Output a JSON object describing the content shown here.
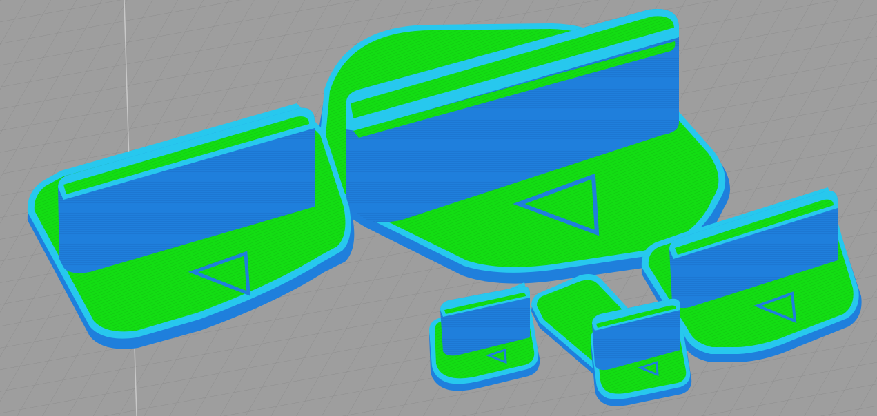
{
  "viewport": {
    "view": "3d-gcode-preview",
    "colors": {
      "bed": "#9e9e9e",
      "grid_line": "#8a8a8a",
      "grid_line_major": "#b0b0b0",
      "perimeter": "#1f7fdc",
      "perimeter_dark": "#1a6bc2",
      "outer_wall": "#27c8ee",
      "top_infill": "#13dd13",
      "top_infill_dark": "#0fbf0f"
    }
  },
  "parts": [
    {
      "name": "stand-large",
      "icon": "triangle-marker-icon"
    },
    {
      "name": "stand-medium-left",
      "icon": "triangle-marker-icon"
    },
    {
      "name": "stand-medium-right",
      "icon": "triangle-marker-icon"
    },
    {
      "name": "stand-small-left",
      "icon": "triangle-marker-icon"
    },
    {
      "name": "stand-small-right",
      "icon": "triangle-marker-icon"
    },
    {
      "name": "flat-plate",
      "icon": ""
    }
  ]
}
